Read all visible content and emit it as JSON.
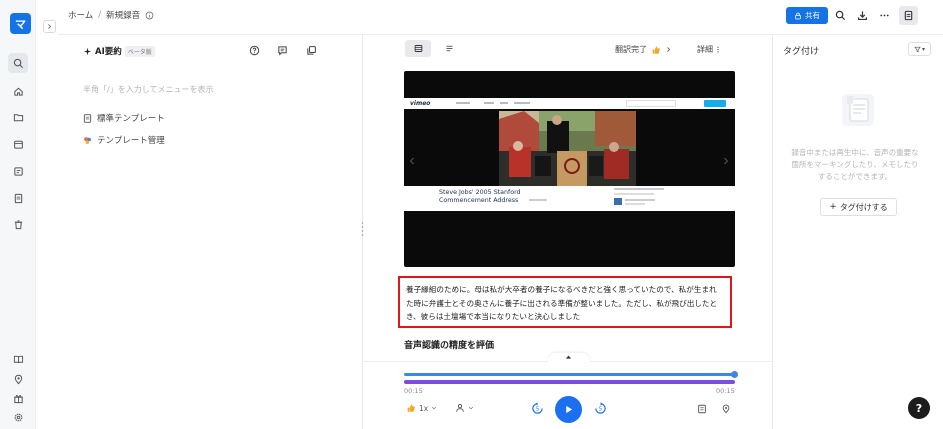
{
  "rail": {
    "logo_text": "マ"
  },
  "breadcrumb": {
    "home": "ホーム",
    "separator": "/",
    "current": "新規録音",
    "info_icon": "info-icon"
  },
  "toolbar": {
    "share_label": "共有",
    "accent": "#1473e6"
  },
  "ai_pane": {
    "title": "AI要約",
    "badge": "ベータ版",
    "hint": "半角「/」を入力してメニューを表示",
    "templates": [
      {
        "label": "標準テンプレート",
        "icon": "document-icon"
      },
      {
        "label": "テンプレート管理",
        "icon": "palette-icon"
      }
    ]
  },
  "player": {
    "trans_status": "翻訳完了",
    "details_label": "詳細",
    "video_title_line1": "Steve Jobs' 2005 Stanford",
    "video_title_line2": "Commencement Address",
    "site_logo": "vimeo",
    "transcript": "養子縁組のために。母は私が大卒者の養子になるべきだと強く思っていたので、私が生まれた時に弁護士とその奥さんに養子に出される準備が整いました。ただし、私が飛び出したとき、彼らは土壇場で本当になりたいと決心しました",
    "eval_title": "音声認識の精度を評価",
    "time_start": "00:15",
    "time_end": "00:15",
    "speed_label": "1x",
    "highlight_color": "#e0161e"
  },
  "tags": {
    "title": "タグ付け",
    "filter_label": "▾",
    "message": "録音中または再生中に、音声の重要な箇所をマーキングしたり、メモしたりすることができます。",
    "add_label": "タグ付けする"
  },
  "help": {
    "label": "?"
  }
}
